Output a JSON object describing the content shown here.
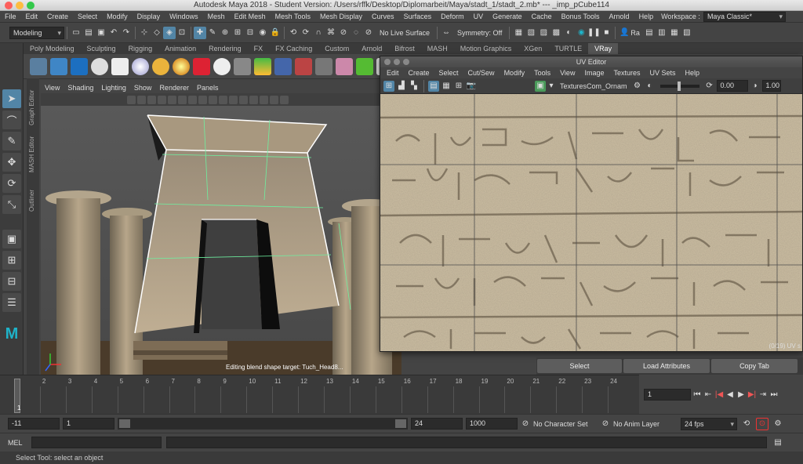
{
  "window": {
    "title": "Autodesk Maya 2018 - Student Version: /Users/rffk/Desktop/Diplomarbeit/Maya/stadt_1/stadt_2.mb*  ---  _imp_pCube114"
  },
  "menubar": {
    "items": [
      "File",
      "Edit",
      "Create",
      "Select",
      "Modify",
      "Display",
      "Windows",
      "Mesh",
      "Edit Mesh",
      "Mesh Tools",
      "Mesh Display",
      "Curves",
      "Surfaces",
      "Deform",
      "UV",
      "Generate",
      "Cache",
      "Bonus Tools",
      "Arnold",
      "Help"
    ],
    "workspace_label": "Workspace :",
    "workspace_value": "Maya Classic*"
  },
  "statusline": {
    "mode": "Modeling",
    "live_surface": "No Live Surface",
    "symmetry": "Symmetry: Off",
    "user_label": "Ra"
  },
  "shelf": {
    "tabs": [
      "Poly Modeling",
      "Sculpting",
      "Rigging",
      "Animation",
      "Rendering",
      "FX",
      "FX Caching",
      "Custom",
      "Arnold",
      "Bifrost",
      "MASH",
      "Motion Graphics",
      "XGen",
      "TURTLE",
      "VRay"
    ],
    "active_tab": "VRay"
  },
  "sidetabs": [
    "Graph Editor",
    "MASH Editor",
    "Outliner"
  ],
  "viewport": {
    "menu": [
      "View",
      "Shading",
      "Lighting",
      "Show",
      "Renderer",
      "Panels"
    ],
    "hud_message": "Editing blend shape target: Tuch_Head8..."
  },
  "uv_editor": {
    "title": "UV Editor",
    "menu": [
      "Edit",
      "Create",
      "Select",
      "Cut/Sew",
      "Modify",
      "Tools",
      "View",
      "Image",
      "Textures",
      "UV Sets",
      "Help"
    ],
    "texture_name": "TexturesCom_Ornam",
    "value_a": "0.00",
    "value_b": "1.00",
    "uv_count": "(0/19) UV s"
  },
  "attribute_buttons": {
    "select": "Select",
    "load": "Load Attributes",
    "copy": "Copy Tab"
  },
  "timeline": {
    "ticks": [
      "1",
      "2",
      "3",
      "4",
      "5",
      "6",
      "7",
      "8",
      "9",
      "10",
      "11",
      "12",
      "13",
      "14",
      "15",
      "16",
      "17",
      "18",
      "19",
      "20",
      "21",
      "22",
      "23",
      "24"
    ],
    "current_frame_marker": "1",
    "current_frame_field": "1"
  },
  "range": {
    "start": "-11",
    "inner_start": "1",
    "inner_end": "24",
    "end": "1000",
    "character_set": "No Character Set",
    "anim_layer": "No Anim Layer",
    "fps": "24 fps"
  },
  "command_line": {
    "language": "MEL"
  },
  "help_line": {
    "text": "Select Tool: select an object"
  },
  "colors": {
    "accent": "#5285a6",
    "maya_logo": "#1fb3c9",
    "wireframe": "#6ef0a0"
  }
}
